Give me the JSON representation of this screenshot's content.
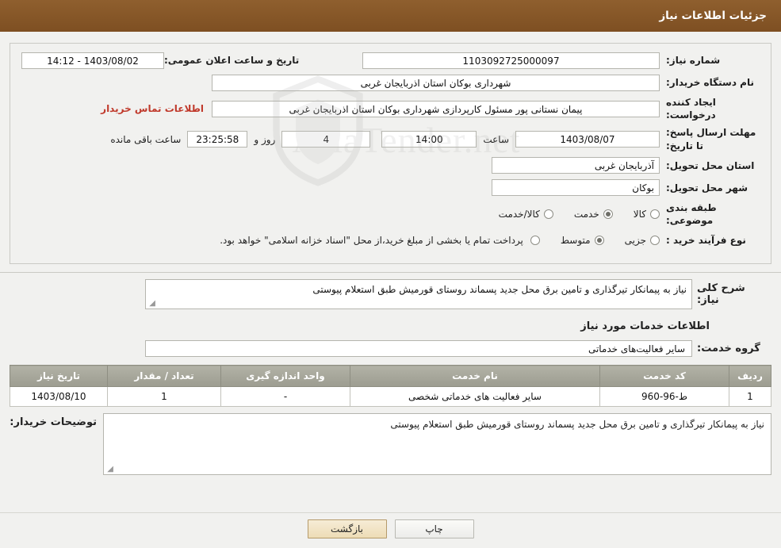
{
  "header": {
    "title": "جزئیات اطلاعات نیاز"
  },
  "watermark": {
    "text": "AriaTender.net"
  },
  "top": {
    "need_no_label": "شماره نیاز:",
    "need_no_value": "1103092725000097",
    "pub_label": "تاریخ و ساعت اعلان عمومی:",
    "pub_value": "1403/08/02 - 14:12",
    "buyer_org_label": "نام دستگاه خریدار:",
    "buyer_org_value": "شهرداری بوکان استان اذربایجان غربی",
    "requester_label": "ایجاد کننده درخواست:",
    "requester_value": "پیمان نستانی پور مسئول کارپردازی شهرداری بوکان استان اذربایجان غربی",
    "contact_link": "اطلاعات تماس خریدار",
    "deadline_label": "مهلت ارسال پاسخ: تا تاریخ:",
    "deadline_date": "1403/08/07",
    "hour_label": "ساعت",
    "hour_value": "14:00",
    "days_value": "4",
    "days_label": "روز و",
    "remain_value": "23:25:58",
    "remain_label": "ساعت باقی مانده",
    "province_label": "استان محل تحویل:",
    "province_value": "آذربایجان غربی",
    "city_label": "شهر محل تحویل:",
    "city_value": "بوکان",
    "category_label": "طبقه بندی موضوعی:",
    "category_options": [
      "کالا",
      "خدمت",
      "کالا/خدمت"
    ],
    "category_selected": "خدمت",
    "purchase_label": "نوع فرآیند خرید :",
    "purchase_options": [
      "جزیی",
      "متوسط"
    ],
    "purchase_selected": "متوسط",
    "purchase_note": "پرداخت تمام یا بخشی از مبلغ خرید،از محل \"اسناد خزانه اسلامی\" خواهد بود."
  },
  "mid": {
    "desc_label": "شرح کلی نیاز:",
    "desc_value": "نیاز به پیمانکار تیرگذاری و  تامین برق محل جدید پسماند روستای قورمیش طبق استعلام پیوستی",
    "services_title": "اطلاعات خدمات مورد نیاز",
    "service_group_label": "گروه خدمت:",
    "service_group_value": "سایر فعالیت‌های خدماتی"
  },
  "table": {
    "headers": [
      "ردیف",
      "کد خدمت",
      "نام خدمت",
      "واحد اندازه گیری",
      "تعداد / مقدار",
      "تاریخ نیاز"
    ],
    "rows": [
      {
        "row": "1",
        "code": "ط-96-960",
        "name": "سایر فعالیت های خدماتی شخصی",
        "unit": "-",
        "qty": "1",
        "date": "1403/08/10"
      }
    ]
  },
  "remarks": {
    "label": "توضیحات خریدار:",
    "value": "نیاز به پیمانکار تیرگذاری و  تامین برق محل جدید پسماند روستای قورمیش طبق استعلام پیوستی"
  },
  "footer": {
    "back_label": "بازگشت",
    "print_label": "چاپ"
  },
  "colors": {
    "header_bg": "#8a5a2b",
    "link": "#c0392b",
    "table_header_bg": "#a8a89c",
    "button_bg": "#f3e6c8"
  }
}
